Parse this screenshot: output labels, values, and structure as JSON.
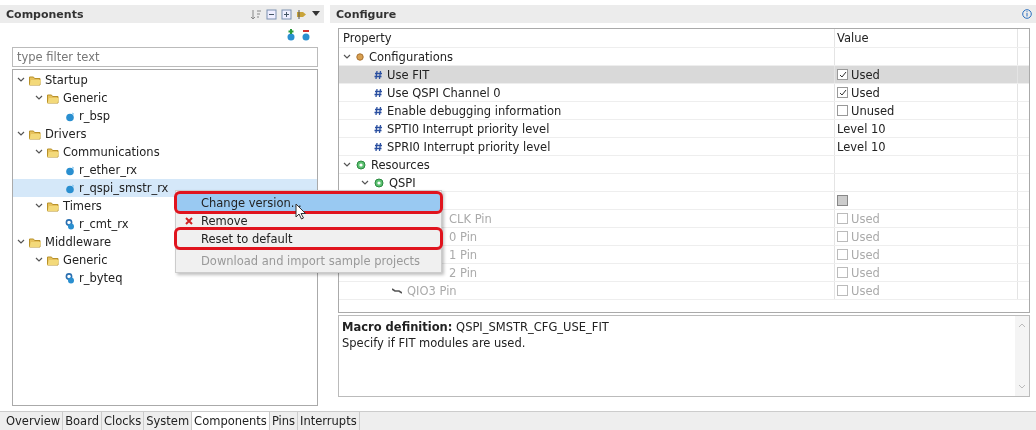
{
  "components_panel": {
    "title": "Components",
    "filter": {
      "placeholder": "type filter text"
    },
    "tree": [
      {
        "label": "Startup",
        "kind": "folder",
        "expanded": true,
        "selected": false,
        "children": [
          {
            "label": "Generic",
            "kind": "folder",
            "expanded": true,
            "selected": false,
            "children": [
              {
                "label": "r_bsp",
                "kind": "component",
                "selected": false
              }
            ]
          }
        ]
      },
      {
        "label": "Drivers",
        "kind": "folder",
        "expanded": true,
        "selected": false,
        "children": [
          {
            "label": "Communications",
            "kind": "folder",
            "expanded": true,
            "selected": false,
            "children": [
              {
                "label": "r_ether_rx",
                "kind": "component",
                "selected": false
              },
              {
                "label": "r_qspi_smstr_rx",
                "kind": "component",
                "selected": true
              }
            ]
          },
          {
            "label": "Timers",
            "kind": "folder",
            "expanded": true,
            "selected": false,
            "children": [
              {
                "label": "r_cmt_rx",
                "kind": "component-gear",
                "selected": false
              }
            ]
          }
        ]
      },
      {
        "label": "Middleware",
        "kind": "folder",
        "expanded": true,
        "selected": false,
        "children": [
          {
            "label": "Generic",
            "kind": "folder",
            "expanded": true,
            "selected": false,
            "children": [
              {
                "label": "r_byteq",
                "kind": "component-gear",
                "selected": false
              }
            ]
          }
        ]
      }
    ]
  },
  "context_menu": {
    "items": [
      {
        "label": "Change version...",
        "kind": "item",
        "selected": true,
        "disabled": false,
        "highlighted": true
      },
      {
        "label": "Remove",
        "kind": "remove",
        "selected": false,
        "disabled": false,
        "highlighted": false
      },
      {
        "label": "Reset to default",
        "kind": "item",
        "selected": false,
        "disabled": false,
        "highlighted": true
      },
      {
        "label": "Download and import sample projects",
        "kind": "separated",
        "selected": false,
        "disabled": true,
        "highlighted": false
      }
    ]
  },
  "configure_panel": {
    "title": "Configure",
    "table": {
      "columns": [
        "Property",
        "Value"
      ],
      "rows": [
        {
          "label": "Configurations",
          "kind": "configurations",
          "expanded": true,
          "selected": false,
          "children": [
            {
              "label": "Use FIT",
              "kind": "setting",
              "selected": true,
              "value": "Used",
              "checked": true
            },
            {
              "label": "Use QSPI Channel 0",
              "kind": "setting",
              "selected": false,
              "value": "Used",
              "checked": true
            },
            {
              "label": "Enable debugging information",
              "kind": "setting",
              "selected": false,
              "value": "Unused",
              "checked": false
            },
            {
              "label": "SPTI0 Interrupt priority level",
              "kind": "setting",
              "selected": false,
              "value": "Level 10"
            },
            {
              "label": "SPRI0 Interrupt priority level",
              "kind": "setting",
              "selected": false,
              "value": "Level 10"
            }
          ]
        },
        {
          "label": "Resources",
          "kind": "resources",
          "expanded": true,
          "selected": false,
          "children": [
            {
              "label": "QSPI",
              "kind": "resources",
              "expanded": true,
              "selected": false,
              "children": [
                {
                  "kind": "pin-hidden",
                  "selected": false,
                  "checked": false,
                  "mixed": true,
                  "disabled": false
                },
                {
                  "label": "CLK Pin",
                  "kind": "pin-clipped",
                  "selected": false,
                  "value": "Used",
                  "checked": false,
                  "disabled": true
                },
                {
                  "label": "0 Pin",
                  "kind": "pin-clipped",
                  "selected": false,
                  "value": "Used",
                  "checked": false,
                  "disabled": true
                },
                {
                  "label": "1 Pin",
                  "kind": "pin-clipped",
                  "selected": false,
                  "value": "Used",
                  "checked": false,
                  "disabled": true
                },
                {
                  "label": "2 Pin",
                  "kind": "pin-clipped",
                  "selected": false,
                  "value": "Used",
                  "checked": false,
                  "disabled": true
                },
                {
                  "label": "QIO3 Pin",
                  "kind": "pin",
                  "selected": false,
                  "value": "Used",
                  "checked": false,
                  "disabled": true
                }
              ]
            }
          ]
        }
      ]
    },
    "description": {
      "text": "**Macro definition:** QSPI_SMSTR_CFG_USE_FIT",
      "detail": "Specify if FIT modules are used."
    }
  },
  "bottom_tabs": [
    {
      "label": "Overview",
      "selected": false
    },
    {
      "label": "Board",
      "selected": false
    },
    {
      "label": "Clocks",
      "selected": false
    },
    {
      "label": "System",
      "selected": false
    },
    {
      "label": "Components",
      "selected": true
    },
    {
      "label": "Pins",
      "selected": false
    },
    {
      "label": "Interrupts",
      "selected": false
    }
  ]
}
